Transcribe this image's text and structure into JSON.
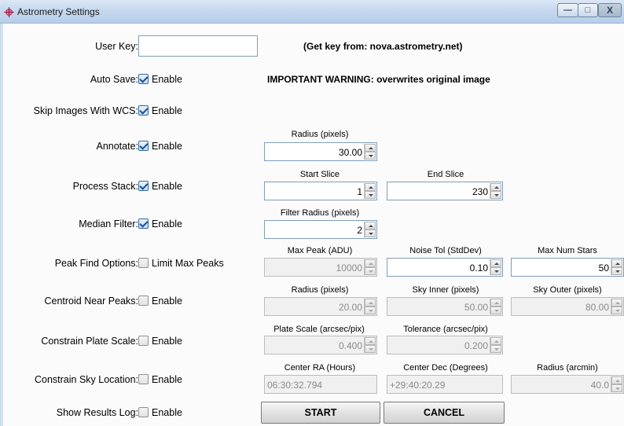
{
  "window": {
    "title": "Astrometry Settings",
    "min": "—",
    "max": "□",
    "close": "X"
  },
  "userkey": {
    "label": "User Key:",
    "value": "",
    "hint": "(Get key from: nova.astrometry.net)"
  },
  "autosave": {
    "label": "Auto Save:",
    "checked": true,
    "enable": "Enable",
    "warning": "IMPORTANT WARNING: overwrites original image"
  },
  "skipwcs": {
    "label": "Skip Images With WCS:",
    "checked": true,
    "enable": "Enable"
  },
  "annotate": {
    "label": "Annotate:",
    "checked": true,
    "enable": "Enable",
    "radius_label": "Radius (pixels)",
    "radius": "30.00"
  },
  "processstack": {
    "label": "Process Stack:",
    "checked": true,
    "enable": "Enable",
    "start_label": "Start Slice",
    "start": "1",
    "end_label": "End Slice",
    "end": "230"
  },
  "median": {
    "label": "Median Filter:",
    "checked": true,
    "enable": "Enable",
    "radius_label": "Filter Radius (pixels)",
    "radius": "2"
  },
  "peakfind": {
    "label": "Peak Find Options:",
    "checked": false,
    "enable": "Limit Max Peaks",
    "maxpeak_label": "Max Peak (ADU)",
    "maxpeak": "10000",
    "noise_label": "Noise Tol (StdDev)",
    "noise": "0.10",
    "maxstars_label": "Max Num Stars",
    "maxstars": "50"
  },
  "centroid": {
    "label": "Centroid Near Peaks:",
    "checked": false,
    "enable": "Enable",
    "radius_label": "Radius (pixels)",
    "radius": "20.00",
    "skyin_label": "Sky Inner (pixels)",
    "skyin": "50.00",
    "skyout_label": "Sky Outer (pixels)",
    "skyout": "80.00"
  },
  "platescale": {
    "label": "Constrain Plate Scale:",
    "checked": false,
    "enable": "Enable",
    "scale_label": "Plate Scale (arcsec/pix)",
    "scale": "0.400",
    "tol_label": "Tolerance (arcsec/pix)",
    "tol": "0.200"
  },
  "skyloc": {
    "label": "Constrain Sky Location:",
    "checked": false,
    "enable": "Enable",
    "ra_label": "Center RA (Hours)",
    "ra": "06:30:32.794",
    "dec_label": "Center Dec (Degrees)",
    "dec": "+29:40:20.29",
    "radius_label": "Radius (arcmin)",
    "radius": "40.0"
  },
  "results": {
    "label": "Show Results Log:",
    "checked": false,
    "enable": "Enable"
  },
  "buttons": {
    "start": "START",
    "cancel": "CANCEL"
  }
}
